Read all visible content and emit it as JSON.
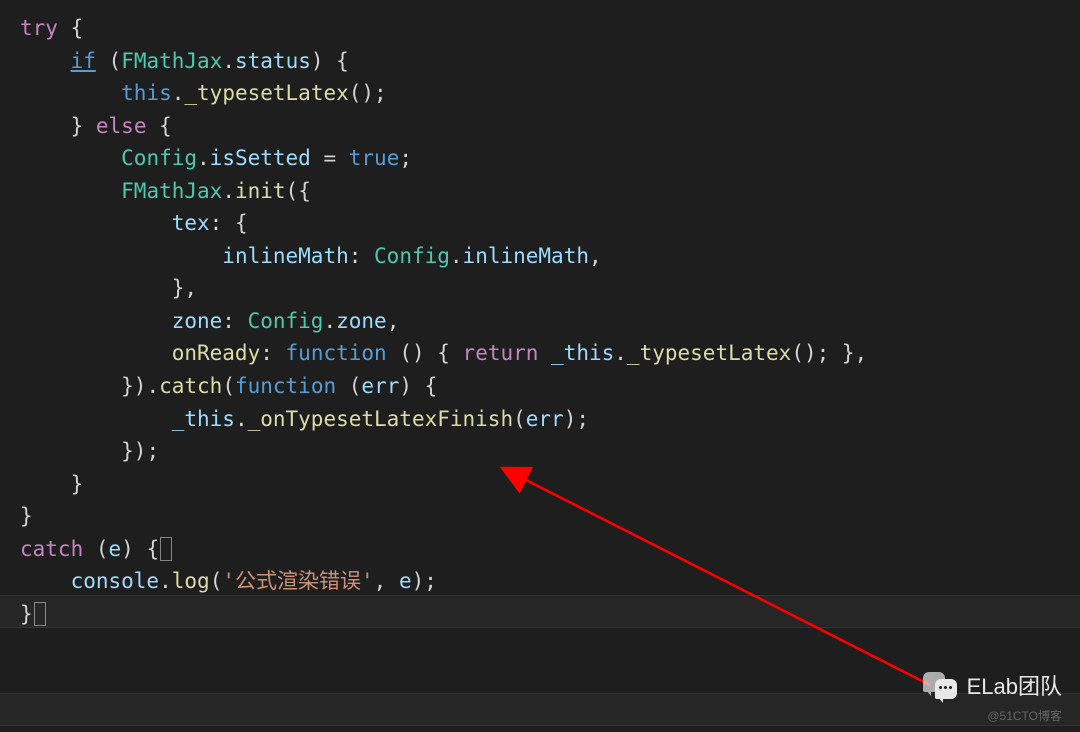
{
  "code": {
    "l1": {
      "try": "try",
      "brace": "{"
    },
    "l2": {
      "if": "if",
      "op": "(",
      "cls": "FMathJax",
      "dot": ".",
      "prop": "status",
      "cp": ")",
      "brace": "{"
    },
    "l3": {
      "this": "this",
      "dot": ".",
      "fn": "_typesetLatex",
      "parens": "();"
    },
    "l4": {
      "cbrace": "}",
      "else": "else",
      "obrace": "{"
    },
    "l5": {
      "cls": "Config",
      "dot": ".",
      "prop": "isSetted",
      "eq": " = ",
      "true": "true",
      "semi": ";"
    },
    "l6": {
      "cls": "FMathJax",
      "dot": ".",
      "fn": "init",
      "op": "({"
    },
    "l7": {
      "prop": "tex",
      "colon": ": {"
    },
    "l8": {
      "prop": "inlineMath",
      "colon": ": ",
      "cls": "Config",
      "dot": ".",
      "prop2": "inlineMath",
      "comma": ","
    },
    "l9": {
      "cbrace": "},"
    },
    "l10": {
      "prop": "zone",
      "colon": ": ",
      "cls": "Config",
      "dot": ".",
      "prop2": "zone",
      "comma": ","
    },
    "l11": {
      "prop": "onReady",
      "colon": ": ",
      "function": "function",
      "parens": " () { ",
      "return": "return",
      "sp": " ",
      "var": "_this",
      "dot": ".",
      "fn": "_typesetLatex",
      "end": "(); },"
    },
    "l12": {
      "close": "}).",
      "fn": "catch",
      "op": "(",
      "function": "function",
      "sp": " (",
      "param": "err",
      "cp": ") {"
    },
    "l13": {
      "var": "_this",
      "dot": ".",
      "fn": "_onTypesetLatexFinish",
      "op": "(",
      "param": "err",
      "cp": ");"
    },
    "l14": {
      "close": "});"
    },
    "l15": {
      "cbrace": "}"
    },
    "l16": {
      "cbrace": "}"
    },
    "l17": {
      "catch": "catch",
      "sp": " (",
      "param": "e",
      "cp": ") ",
      "obrace": "{"
    },
    "l18": {
      "obj": "console",
      "dot": ".",
      "fn": "log",
      "op": "(",
      "str": "'公式渲染错误'",
      "comma": ", ",
      "param": "e",
      "cp": ");"
    },
    "l19": {
      "cbrace": "}"
    }
  },
  "watermark": {
    "text": "ELab团队"
  },
  "copyright": {
    "text": "@51CTO博客"
  }
}
